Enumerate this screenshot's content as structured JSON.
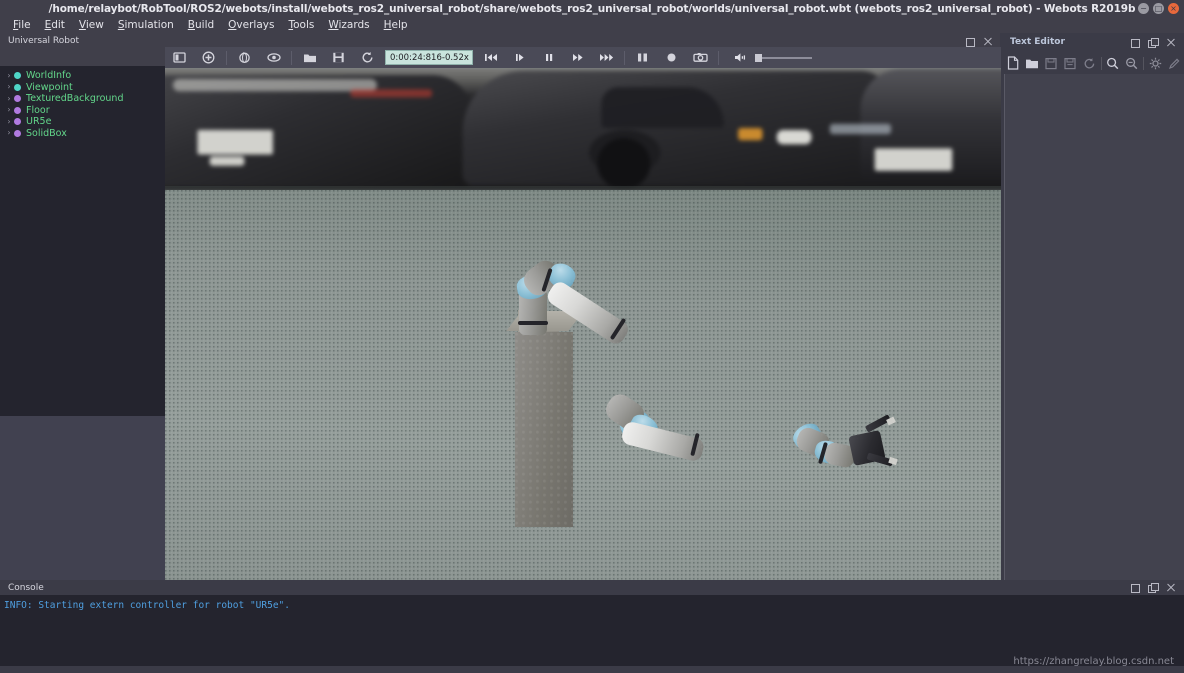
{
  "window": {
    "title": "/home/relaybot/RobTool/ROS2/webots/install/webots_ros2_universal_robot/share/webots_ros2_universal_robot/worlds/universal_robot.wbt (webots_ros2_universal_robot) - Webots R2019b",
    "controls": [
      {
        "name": "minimize-button",
        "glyph": "−"
      },
      {
        "name": "maximize-button",
        "glyph": "□"
      },
      {
        "name": "close-button",
        "glyph": "×"
      }
    ]
  },
  "menubar": {
    "items": [
      {
        "mnemonic": "F",
        "rest": "ile"
      },
      {
        "mnemonic": "E",
        "rest": "dit"
      },
      {
        "mnemonic": "V",
        "rest": "iew"
      },
      {
        "mnemonic": "S",
        "rest": "imulation"
      },
      {
        "mnemonic": "B",
        "rest": "uild"
      },
      {
        "mnemonic": "O",
        "rest": "verlays"
      },
      {
        "mnemonic": "T",
        "rest": "ools"
      },
      {
        "mnemonic": "W",
        "rest": "izards"
      },
      {
        "mnemonic": "H",
        "rest": "elp"
      }
    ]
  },
  "scene_panel": {
    "tab_label": "Universal Robot",
    "dock_buttons": [
      "undock-icon",
      "close-icon"
    ],
    "tree_items": [
      {
        "label": "WorldInfo",
        "dot_color": "#4fd6c8",
        "chevron": "›"
      },
      {
        "label": "Viewpoint",
        "dot_color": "#4fd6c8",
        "chevron": "›"
      },
      {
        "label": "TexturedBackground",
        "dot_color": "#b07ae0",
        "chevron": "›"
      },
      {
        "label": "Floor",
        "dot_color": "#b07ae0",
        "chevron": "›"
      },
      {
        "label": "UR5e",
        "dot_color": "#b07ae0",
        "chevron": "›"
      },
      {
        "label": "SolidBox",
        "dot_color": "#b07ae0",
        "chevron": "›"
      }
    ],
    "label_color": "#63d78b"
  },
  "simulation_toolbar": {
    "left_icons": [
      "toggle-sidebar-icon",
      "add-node-icon",
      "orientation-icon",
      "follow-object-icon",
      "open-world-icon",
      "save-world-icon",
      "reload-world-icon"
    ],
    "time_field": {
      "time": "0:00:24:816",
      "separator": "-",
      "speed": "0.52x",
      "background_color": "#c9e4dd"
    },
    "playback_icons": [
      "rewind-icon",
      "step-icon",
      "pause-icon",
      "run-icon",
      "fast-icon"
    ],
    "capture_icons": [
      "movie-icon",
      "record-icon",
      "screenshot-icon"
    ],
    "sound": {
      "icon": "volume-icon",
      "value": 0
    }
  },
  "viewport": {
    "name": "3d-simulation-view",
    "scene": "UR5e robot arm with two-finger gripper mounted on a concrete pedestal, textured parking-garage background, gray-green dotted floor"
  },
  "text_editor": {
    "title": "Text Editor",
    "dock_buttons": [
      "undock-icon",
      "float-icon",
      "close-icon"
    ],
    "toolbar_icons": [
      "new-file-icon",
      "open-file-icon",
      "save-file-icon",
      "save-as-icon",
      "revert-icon",
      "find-icon",
      "find-replace-icon",
      "settings-icon",
      "edit-icon"
    ],
    "content": ""
  },
  "console": {
    "title": "Console",
    "dock_buttons": [
      "undock-icon",
      "float-icon",
      "close-icon"
    ],
    "lines": [
      "INFO: Starting extern controller for robot \"UR5e\"."
    ],
    "text_color": "#4f9fe0"
  },
  "watermark": {
    "text": "https://zhangrelay.blog.csdn.net"
  }
}
